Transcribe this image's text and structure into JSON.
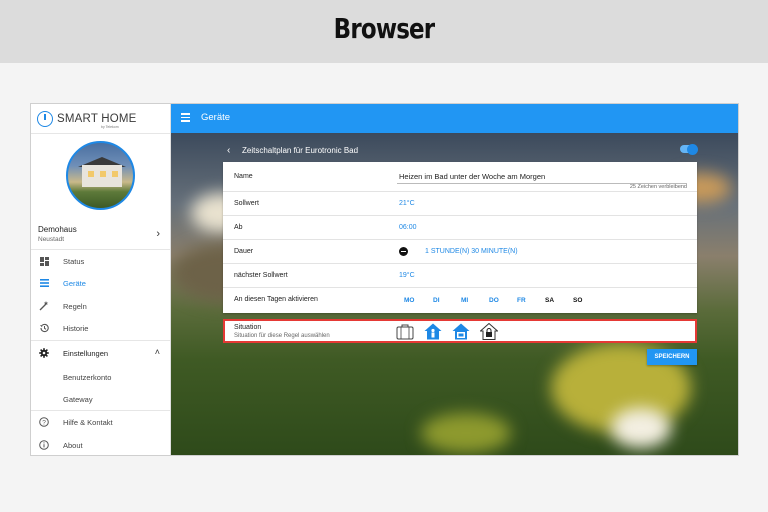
{
  "page": {
    "heading": "Browser"
  },
  "sidebar": {
    "logo": {
      "name": "SMART HOME",
      "by": "by Telekom"
    },
    "home": {
      "title": "Demohaus",
      "subtitle": "Neustadt"
    },
    "items": [
      {
        "label": "Status",
        "icon": "dashboard-icon"
      },
      {
        "label": "Geräte",
        "icon": "list-icon"
      },
      {
        "label": "Regeln",
        "icon": "magic-wand-icon"
      },
      {
        "label": "Historie",
        "icon": "history-icon"
      },
      {
        "label": "Einstellungen",
        "icon": "gear-icon"
      },
      {
        "label": "Benutzerkonto"
      },
      {
        "label": "Gateway"
      },
      {
        "label": "Hilfe & Kontakt",
        "icon": "help-icon"
      },
      {
        "label": "About",
        "icon": "info-icon"
      }
    ]
  },
  "appbar": {
    "title": "Geräte"
  },
  "schedule": {
    "header_title": "Zeitschaltplan für Eurotronic Bad",
    "rows": {
      "name": {
        "label": "Name",
        "value": "Heizen im Bad unter der Woche am Morgen",
        "hint": "25 Zeichen verbleibend"
      },
      "sollwert": {
        "label": "Sollwert",
        "value": "21°C"
      },
      "ab": {
        "label": "Ab",
        "value": "06:00"
      },
      "dauer": {
        "label": "Dauer",
        "value": "1 STUNDE(N) 30 MINUTE(N)"
      },
      "next": {
        "label": "nächster Sollwert",
        "value": "19°C"
      },
      "days": {
        "label": "An diesen Tagen aktivieren",
        "items": [
          "MO",
          "DI",
          "MI",
          "DO",
          "FR",
          "SA",
          "SO"
        ]
      }
    },
    "situation": {
      "label": "Situation",
      "subtitle": "Situation für diese Regel auswählen"
    },
    "save_label": "SPEICHERN"
  },
  "colors": {
    "accent": "#2196f3",
    "highlight": "#e53935"
  }
}
